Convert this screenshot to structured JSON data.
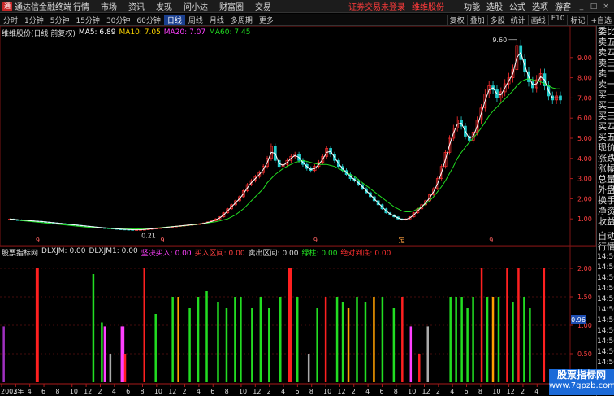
{
  "title_bar": {
    "app_title": "通达信金融终端",
    "menus": [
      "行情",
      "市场",
      "资讯",
      "发现",
      "问小达",
      "财富圈",
      "交易"
    ],
    "login_notice": "证券交易未登录",
    "broker": "维维股份",
    "right_items": [
      "功能",
      "选股",
      "公式",
      "选项",
      "游客"
    ]
  },
  "toolbar": {
    "periods": [
      "分时",
      "1分钟",
      "5分钟",
      "15分钟",
      "30分钟",
      "60分钟",
      "日线",
      "周线",
      "月线",
      "多周期",
      "更多"
    ],
    "active_period": "日线",
    "buttons": [
      "复权",
      "叠加",
      "多股",
      "统计",
      "画线",
      "F10",
      "标记",
      "+自选"
    ]
  },
  "price_panel": {
    "stock_label": "维维股份(日线 前复权)",
    "ma_items": [
      {
        "label": "MA5: 6.89",
        "color": "#ffffff"
      },
      {
        "label": "MA10: 7.05",
        "color": "#ffd700"
      },
      {
        "label": "MA20: 7.07",
        "color": "#ff40ff"
      },
      {
        "label": "MA60: 7.45",
        "color": "#22dd22"
      }
    ],
    "y_ticks": [
      "9.00",
      "8.00",
      "7.00",
      "6.00",
      "5.00",
      "4.00",
      "3.00",
      "2.00",
      "1.00"
    ],
    "y_tick_values": [
      9,
      8,
      7,
      6,
      5,
      4,
      3,
      2,
      1
    ],
    "high_label": "9.60",
    "low_label": "0.21",
    "marker_labels": [
      "9",
      "9",
      "9",
      "定",
      "9"
    ],
    "close_series": [
      0.99,
      0.96,
      0.95,
      0.94,
      0.92,
      0.9,
      0.89,
      0.88,
      0.86,
      0.84,
      0.82,
      0.8,
      0.78,
      0.76,
      0.74,
      0.72,
      0.7,
      0.68,
      0.66,
      0.64,
      0.62,
      0.6,
      0.58,
      0.56,
      0.55,
      0.54,
      0.52,
      0.5,
      0.49,
      0.48,
      0.47,
      0.46,
      0.46,
      0.47,
      0.48,
      0.5,
      0.52,
      0.54,
      0.56,
      0.58,
      0.6,
      0.62,
      0.64,
      0.66,
      0.68,
      0.7,
      0.72,
      0.74,
      0.76,
      0.8,
      0.85,
      0.9,
      1.0,
      1.1,
      1.3,
      1.5,
      1.7,
      1.9,
      2.1,
      2.4,
      2.7,
      2.9,
      3.1,
      3.3,
      3.6,
      4.0,
      4.6,
      3.9,
      3.6,
      3.7,
      3.9,
      4.1,
      4.2,
      3.9,
      3.7,
      3.5,
      3.4,
      3.6,
      3.8,
      4.1,
      4.5,
      4.2,
      3.9,
      3.6,
      3.4,
      3.2,
      3.0,
      2.9,
      2.7,
      2.5,
      2.3,
      2.1,
      1.9,
      1.7,
      1.5,
      1.3,
      1.2,
      1.1,
      1.0,
      0.95,
      1.0,
      1.1,
      1.3,
      1.5,
      1.7,
      1.9,
      2.2,
      2.5,
      3.0,
      3.6,
      4.3,
      5.0,
      5.5,
      5.9,
      5.6,
      5.1,
      4.9,
      5.3,
      5.9,
      6.5,
      7.2,
      7.6,
      7.4,
      7.0,
      7.3,
      7.7,
      8.0,
      8.4,
      9.6,
      8.9,
      8.3,
      7.8,
      7.5,
      7.9,
      8.2,
      7.6,
      7.1,
      6.9,
      7.1,
      6.9
    ],
    "ma60_series": [
      1.0,
      0.97,
      0.95,
      0.92,
      0.9,
      0.88,
      0.86,
      0.84,
      0.82,
      0.8,
      0.78,
      0.76,
      0.74,
      0.72,
      0.7,
      0.68,
      0.66,
      0.64,
      0.62,
      0.6,
      0.58,
      0.57,
      0.56,
      0.55,
      0.54,
      0.53,
      0.52,
      0.51,
      0.5,
      0.5,
      0.5,
      0.5,
      0.5,
      0.51,
      0.52,
      0.53,
      0.54,
      0.55,
      0.56,
      0.58,
      0.6,
      0.62,
      0.63,
      0.64,
      0.66,
      0.68,
      0.7,
      0.72,
      0.75,
      0.78,
      0.8,
      0.83,
      0.86,
      0.9,
      0.95,
      1.0,
      1.1,
      1.2,
      1.35,
      1.5,
      1.7,
      1.9,
      2.1,
      2.3,
      2.5,
      2.8,
      3.0,
      3.2,
      3.35,
      3.5,
      3.6,
      3.7,
      3.8,
      3.85,
      3.9,
      3.85,
      3.8,
      3.75,
      3.7,
      3.7,
      3.7,
      3.65,
      3.6,
      3.5,
      3.4,
      3.3,
      3.2,
      3.1,
      2.95,
      2.8,
      2.65,
      2.5,
      2.35,
      2.2,
      2.05,
      1.9,
      1.75,
      1.6,
      1.5,
      1.4,
      1.35,
      1.35,
      1.4,
      1.5,
      1.6,
      1.75,
      1.9,
      2.1,
      2.35,
      2.6,
      2.9,
      3.25,
      3.6,
      4.0,
      4.3,
      4.55,
      4.8,
      5.0,
      5.25,
      5.5,
      5.8,
      6.1,
      6.35,
      6.55,
      6.75,
      6.95,
      7.15,
      7.35,
      7.6,
      7.8,
      7.9,
      7.95,
      7.9,
      7.85,
      7.8,
      7.7,
      7.6,
      7.5,
      7.45,
      7.45
    ]
  },
  "indicator_panel": {
    "name": "股票指标网",
    "items": [
      {
        "label": "DLXJM: 0.00",
        "color": "#dddddd"
      },
      {
        "label": "DLXJM1: 0.00",
        "color": "#dddddd"
      },
      {
        "label": "坚决买入: 0.00",
        "color": "#ff40ff"
      },
      {
        "label": "买入区间: 0.00",
        "color": "#ff4040"
      },
      {
        "label": "卖出区间: 0.00",
        "color": "#dddddd"
      },
      {
        "label": "绿柱: 0.00",
        "color": "#22dd22"
      },
      {
        "label": "绝对到底: 0.00",
        "color": "#ff3030"
      }
    ],
    "y_ticks": [
      "2.00",
      "1.50",
      "1.00",
      "0.50"
    ],
    "y_tick_values": [
      2.0,
      1.5,
      1.0,
      0.5
    ],
    "current_value": "0.96",
    "bars": [
      {
        "x": 0.002,
        "v": 0.98,
        "c": "#a030c0"
      },
      {
        "x": 0.06,
        "v": 2.0,
        "c": "#ff2020"
      },
      {
        "x": 0.062,
        "v": 2.0,
        "c": "#ff2020"
      },
      {
        "x": 0.16,
        "v": 1.9,
        "c": "#22dd22"
      },
      {
        "x": 0.175,
        "v": 1.05,
        "c": "#22dd22"
      },
      {
        "x": 0.18,
        "v": 0.98,
        "c": "#ff40ff"
      },
      {
        "x": 0.19,
        "v": 0.5,
        "c": "#aaaaaa"
      },
      {
        "x": 0.21,
        "v": 0.98,
        "c": "#ff40ff"
      },
      {
        "x": 0.213,
        "v": 0.98,
        "c": "#ff40ff"
      },
      {
        "x": 0.216,
        "v": 0.5,
        "c": "#ff2020"
      },
      {
        "x": 0.25,
        "v": 2.0,
        "c": "#ff2020"
      },
      {
        "x": 0.27,
        "v": 1.2,
        "c": "#22dd22"
      },
      {
        "x": 0.3,
        "v": 1.5,
        "c": "#22dd22"
      },
      {
        "x": 0.31,
        "v": 1.5,
        "c": "#ffa000"
      },
      {
        "x": 0.33,
        "v": 1.3,
        "c": "#22dd22"
      },
      {
        "x": 0.345,
        "v": 1.5,
        "c": "#22dd22"
      },
      {
        "x": 0.36,
        "v": 1.6,
        "c": "#22dd22"
      },
      {
        "x": 0.38,
        "v": 1.4,
        "c": "#22dd22"
      },
      {
        "x": 0.395,
        "v": 1.3,
        "c": "#22dd22"
      },
      {
        "x": 0.41,
        "v": 1.5,
        "c": "#22dd22"
      },
      {
        "x": 0.42,
        "v": 1.5,
        "c": "#22dd22"
      },
      {
        "x": 0.44,
        "v": 1.3,
        "c": "#22dd22"
      },
      {
        "x": 0.455,
        "v": 1.5,
        "c": "#22dd22"
      },
      {
        "x": 0.47,
        "v": 1.3,
        "c": "#22dd22"
      },
      {
        "x": 0.49,
        "v": 1.5,
        "c": "#22dd22"
      },
      {
        "x": 0.505,
        "v": 2.0,
        "c": "#ff2020"
      },
      {
        "x": 0.508,
        "v": 2.0,
        "c": "#ff2020"
      },
      {
        "x": 0.52,
        "v": 1.5,
        "c": "#22dd22"
      },
      {
        "x": 0.54,
        "v": 0.5,
        "c": "#aaaaaa"
      },
      {
        "x": 0.555,
        "v": 1.3,
        "c": "#22dd22"
      },
      {
        "x": 0.57,
        "v": 1.5,
        "c": "#ff2020"
      },
      {
        "x": 0.59,
        "v": 1.5,
        "c": "#22dd22"
      },
      {
        "x": 0.6,
        "v": 1.4,
        "c": "#22dd22"
      },
      {
        "x": 0.61,
        "v": 1.3,
        "c": "#ffa000"
      },
      {
        "x": 0.625,
        "v": 1.5,
        "c": "#22dd22"
      },
      {
        "x": 0.64,
        "v": 1.4,
        "c": "#22dd22"
      },
      {
        "x": 0.655,
        "v": 1.5,
        "c": "#ffa000"
      },
      {
        "x": 0.67,
        "v": 1.5,
        "c": "#22dd22"
      },
      {
        "x": 0.69,
        "v": 1.3,
        "c": "#22dd22"
      },
      {
        "x": 0.705,
        "v": 1.5,
        "c": "#ff2020"
      },
      {
        "x": 0.72,
        "v": 0.98,
        "c": "#ff40ff"
      },
      {
        "x": 0.735,
        "v": 0.5,
        "c": "#ff2020"
      },
      {
        "x": 0.75,
        "v": 0.98,
        "c": "#aaaaaa"
      },
      {
        "x": 0.79,
        "v": 1.5,
        "c": "#22dd22"
      },
      {
        "x": 0.8,
        "v": 1.5,
        "c": "#22dd22"
      },
      {
        "x": 0.81,
        "v": 1.5,
        "c": "#22dd22"
      },
      {
        "x": 0.82,
        "v": 1.3,
        "c": "#22dd22"
      },
      {
        "x": 0.83,
        "v": 1.5,
        "c": "#22dd22"
      },
      {
        "x": 0.845,
        "v": 2.0,
        "c": "#ff2020"
      },
      {
        "x": 0.855,
        "v": 1.5,
        "c": "#22dd22"
      },
      {
        "x": 0.865,
        "v": 1.5,
        "c": "#ffa000"
      },
      {
        "x": 0.875,
        "v": 1.5,
        "c": "#22dd22"
      },
      {
        "x": 0.89,
        "v": 2.0,
        "c": "#ff2020"
      },
      {
        "x": 0.9,
        "v": 1.4,
        "c": "#22dd22"
      },
      {
        "x": 0.91,
        "v": 2.0,
        "c": "#ff2020"
      },
      {
        "x": 0.92,
        "v": 1.5,
        "c": "#22dd22"
      },
      {
        "x": 0.93,
        "v": 1.3,
        "c": "#22dd22"
      },
      {
        "x": 0.955,
        "v": 2.0,
        "c": "#ff2020"
      }
    ]
  },
  "x_axis": {
    "labels": [
      "2003年",
      "2",
      "4",
      "6",
      "8",
      "10",
      "12",
      "2",
      "4",
      "6",
      "8",
      "10",
      "12",
      "2",
      "4",
      "6",
      "8",
      "10",
      "12",
      "2",
      "4",
      "6",
      "8",
      "10",
      "12",
      "2",
      "4",
      "6",
      "8",
      "10",
      "12",
      "2",
      "4",
      "6",
      "8",
      "10",
      "12",
      "2",
      "4",
      "6",
      "8"
    ]
  },
  "right_panel": {
    "items": [
      "委比",
      "卖五",
      "卖四",
      "卖三",
      "卖二",
      "卖一",
      "买一",
      "买二",
      "买三",
      "买四",
      "买五",
      "现价",
      "涨跌",
      "涨幅",
      "总量",
      "外盘",
      "换手",
      "净资",
      "收益"
    ],
    "items2": [
      "自动",
      "行情"
    ],
    "times": [
      "14:50",
      "14:50",
      "14:50",
      "14:50",
      "14:50",
      "14:50",
      "14:50",
      "14:50",
      "14:50",
      "14:50",
      "14:50"
    ]
  },
  "watermark": {
    "line1": "股票指标网",
    "line2": "www.7gpzb.com"
  }
}
